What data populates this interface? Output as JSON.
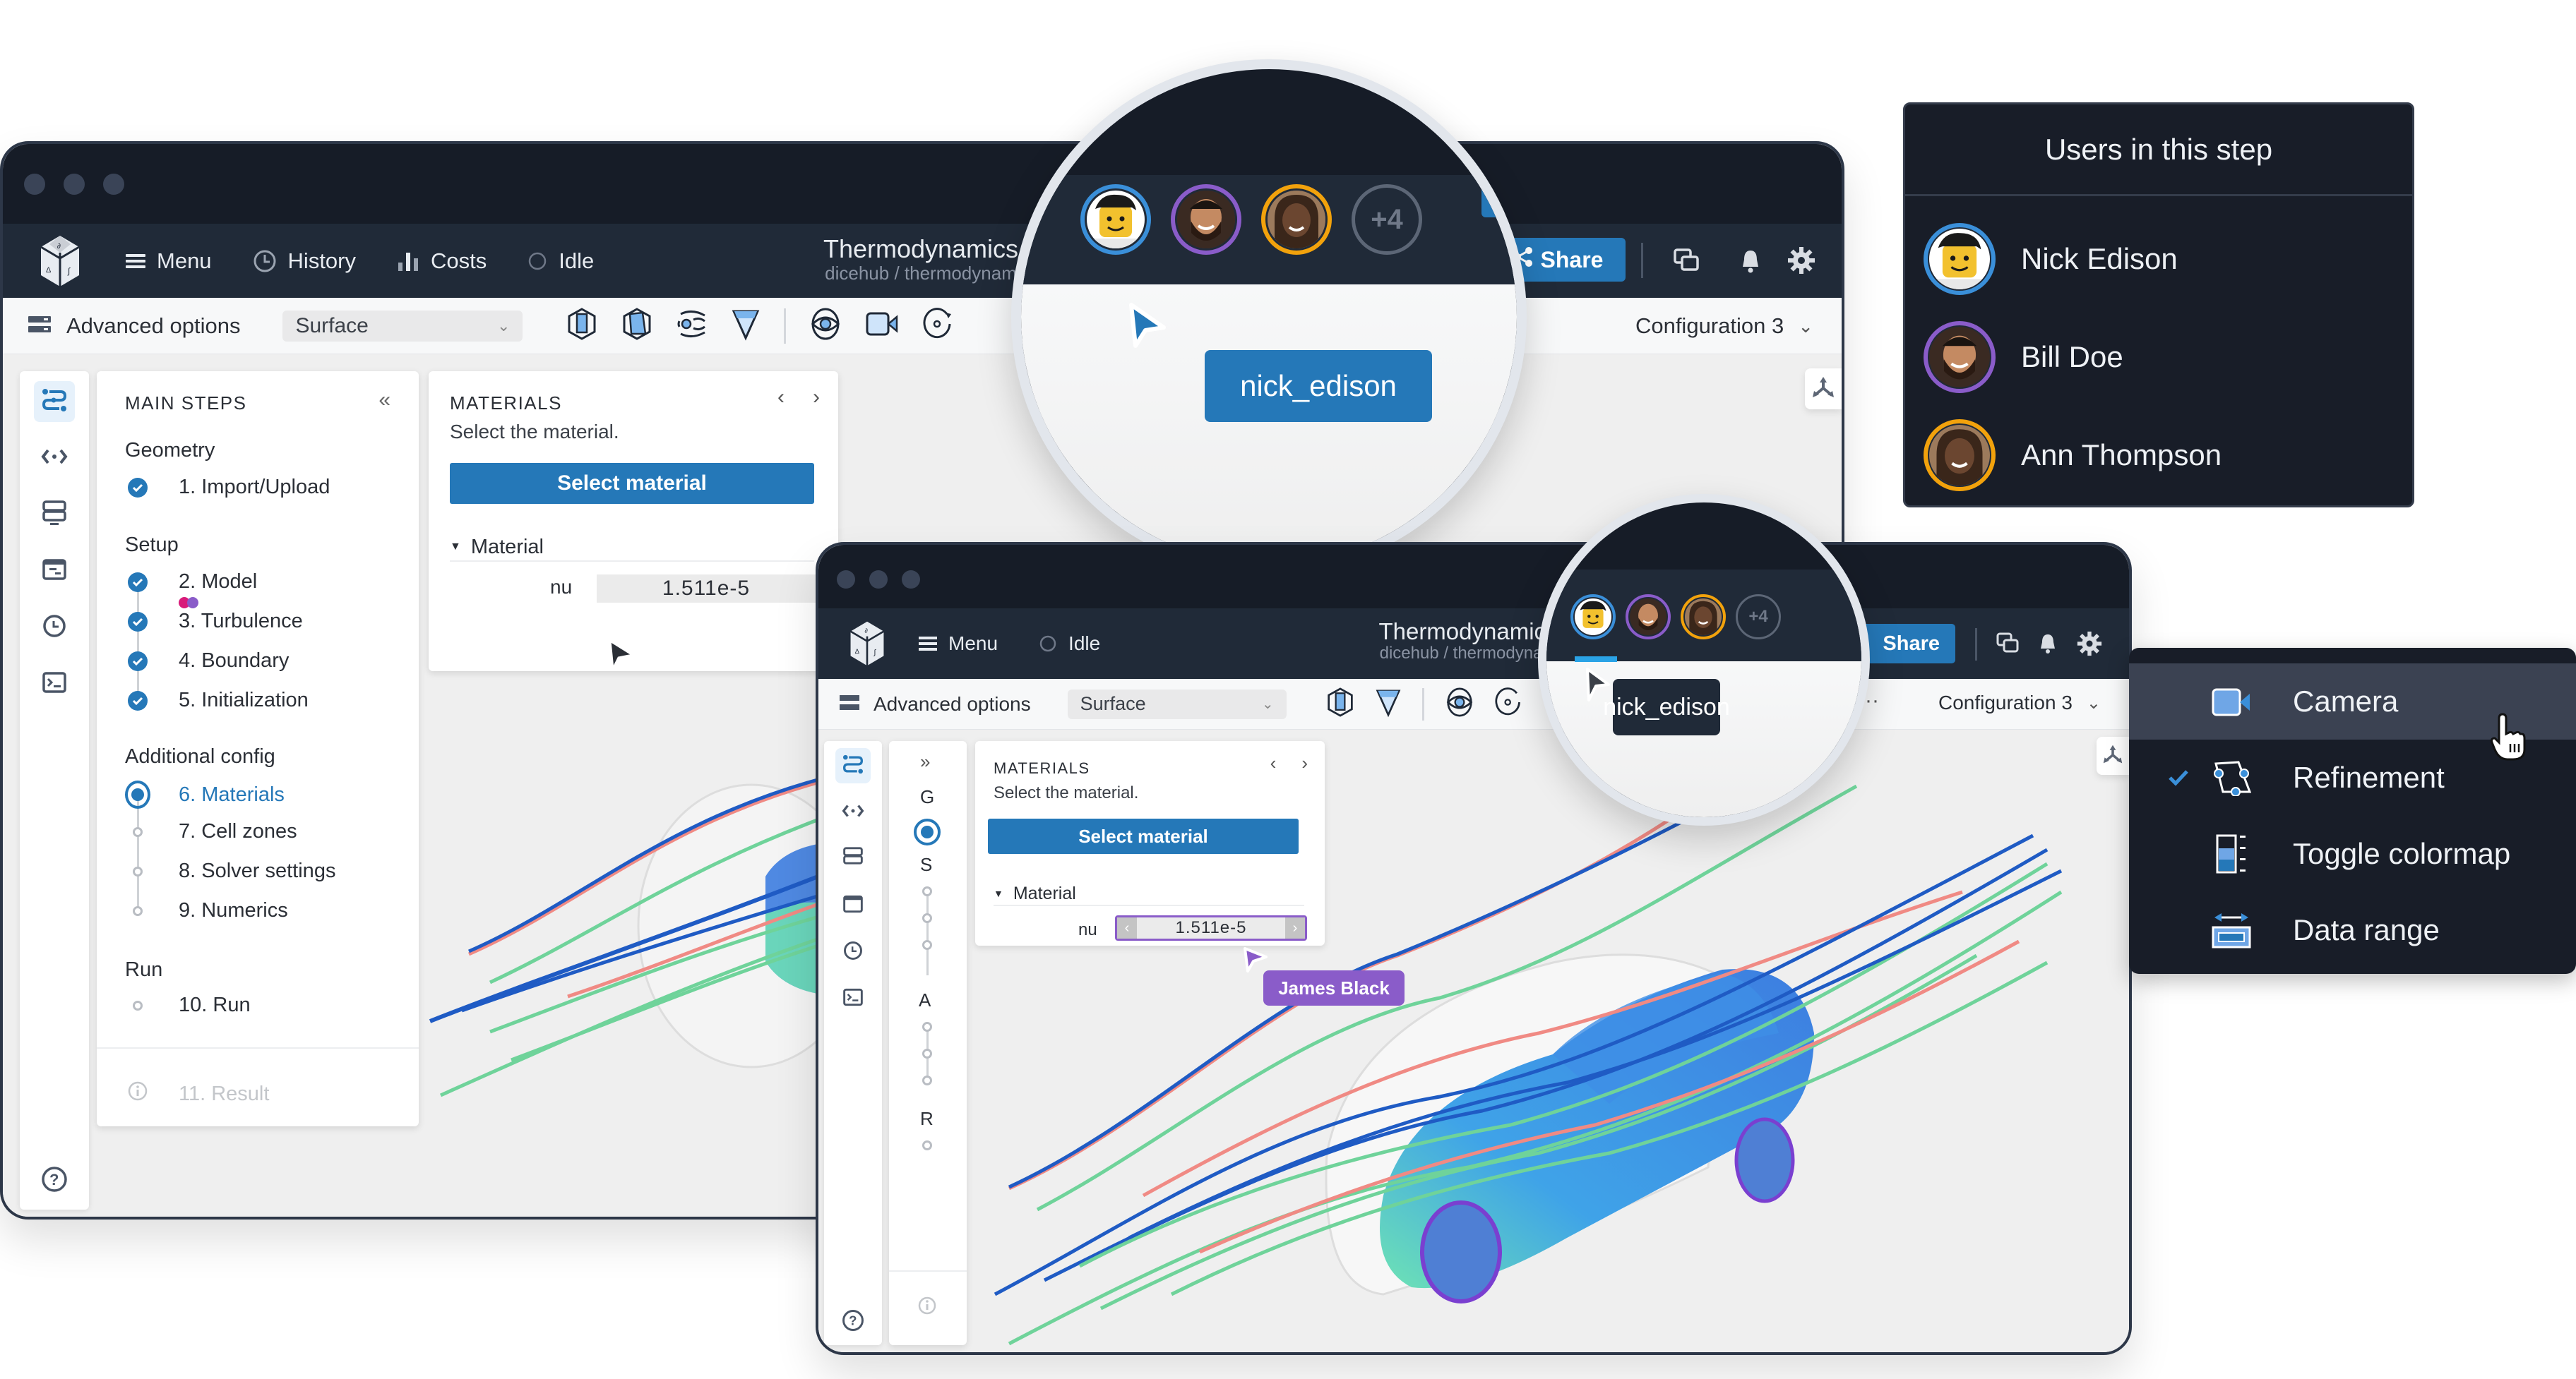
{
  "app": {
    "title": "Thermodynamics",
    "breadcrumb": "dicehub / thermodynam",
    "nav": {
      "menu": "Menu",
      "history": "History",
      "costs": "Costs",
      "status": "Idle"
    },
    "share_label": "Share",
    "advanced_options": "Advanced options",
    "view_mode": "Surface",
    "configuration": "Configuration 3"
  },
  "steps": {
    "title": "MAIN STEPS",
    "collapse_icon": "chevrons-left-icon",
    "groups": [
      {
        "label": "Geometry",
        "items": [
          {
            "label": "1. Import/Upload",
            "state": "done"
          }
        ]
      },
      {
        "label": "Setup",
        "items": [
          {
            "label": "2. Model",
            "state": "done"
          },
          {
            "label": "3. Turbulence",
            "state": "done"
          },
          {
            "label": "4. Boundary",
            "state": "done"
          },
          {
            "label": "5. Initialization",
            "state": "done"
          }
        ]
      },
      {
        "label": "Additional config",
        "items": [
          {
            "label": "6. Materials",
            "state": "current"
          },
          {
            "label": "7. Cell zones",
            "state": "todo"
          },
          {
            "label": "8. Solver settings",
            "state": "todo"
          },
          {
            "label": "9. Numerics",
            "state": "todo"
          }
        ]
      },
      {
        "label": "Run",
        "items": [
          {
            "label": "10. Run",
            "state": "todo"
          }
        ]
      }
    ],
    "result": "11. Result",
    "presence_colors": [
      "#d81b7a",
      "#8a5cc9"
    ]
  },
  "compact_steps": {
    "expand_icon": "chevrons-right-icon",
    "letters": [
      "G",
      "S",
      "A",
      "R"
    ]
  },
  "materials": {
    "title": "MATERIALS",
    "description": "Select the material.",
    "button": "Select material",
    "section": "Material",
    "field_label": "nu",
    "field_value": "1.511e-5"
  },
  "presence": {
    "users": [
      {
        "name": "Nick Edison",
        "handle": "nick_edison",
        "ring": "#3a8fd9"
      },
      {
        "name": "Bill Doe",
        "ring": "#8a5cc9"
      },
      {
        "name": "Ann Thompson",
        "ring": "#f2a20c"
      }
    ],
    "more_count": "+4",
    "cursor_label_main": "nick_edison",
    "cursor_label_second": "James Black",
    "cursor_label_second_color": "#8a5cc9"
  },
  "users_panel": {
    "title": "Users in this step",
    "users": [
      "Nick Edison",
      "Bill Doe",
      "Ann Thompson"
    ]
  },
  "context_menu": {
    "items": [
      {
        "label": "Camera",
        "icon": "camera-icon",
        "checked": false,
        "hover": true
      },
      {
        "label": "Refinement",
        "icon": "refinement-icon",
        "checked": true,
        "hover": false
      },
      {
        "label": "Toggle colormap",
        "icon": "colormap-icon",
        "checked": false,
        "hover": false
      },
      {
        "label": "Data range",
        "icon": "data-range-icon",
        "checked": false,
        "hover": false
      }
    ]
  },
  "colors": {
    "accent": "#2578b8",
    "dark_bg": "#161c27",
    "header_bg": "#202a38",
    "stream_blue": "#1f5bc4",
    "stream_green": "#6fd39a",
    "stream_red": "#f08a84"
  }
}
